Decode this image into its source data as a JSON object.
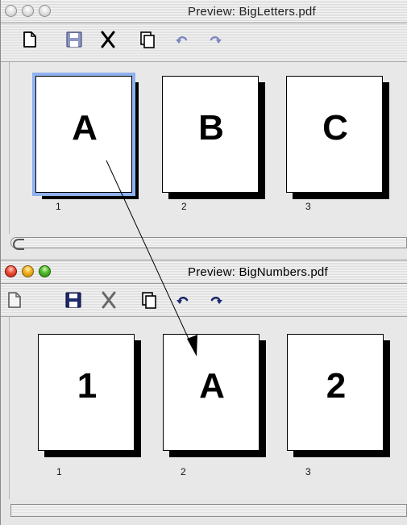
{
  "windows": {
    "top": {
      "title": "Preview: BigLetters.pdf",
      "active": false,
      "pages": [
        {
          "glyph": "A",
          "number": "1",
          "selected": true
        },
        {
          "glyph": "B",
          "number": "2",
          "selected": false
        },
        {
          "glyph": "C",
          "number": "3",
          "selected": false
        }
      ]
    },
    "bottom": {
      "title": "Preview: BigNumbers.pdf",
      "active": true,
      "pages": [
        {
          "glyph": "1",
          "number": "1",
          "selected": false
        },
        {
          "glyph": "A",
          "number": "2",
          "selected": false
        },
        {
          "glyph": "2",
          "number": "3",
          "selected": false
        }
      ]
    }
  },
  "toolbar_icons": [
    "new-document-icon",
    "save-icon",
    "cut-icon",
    "copy-icon",
    "undo-icon",
    "redo-icon"
  ],
  "colors": {
    "selection": "#8fb1ee",
    "save_icon_active": "#1f2a6b",
    "close_button": "#e14a34",
    "minimize_button": "#f1b12a",
    "zoom_button": "#46b82a"
  }
}
